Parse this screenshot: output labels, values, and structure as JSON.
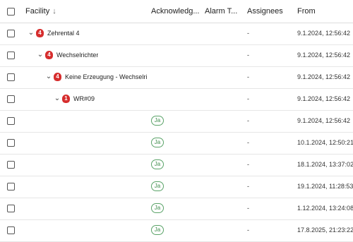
{
  "columns": {
    "facility": "Facility",
    "acknowledged": "Acknowledg...",
    "alarm_type": "Alarm T...",
    "assignees": "Assignees",
    "from": "From"
  },
  "icons": {
    "sort": "arrow-down-icon",
    "expand": "chevron-down-icon",
    "alarm": "alarm-count-badge-icon"
  },
  "colors": {
    "alarm_red": "#d62d2d",
    "ack_green": "#3d8c4b"
  },
  "rows": [
    {
      "type": "tree",
      "level": 0,
      "count": "4",
      "label": "Zehrental 4",
      "assignees": "-",
      "from": "9.1.2024, 12:56:42"
    },
    {
      "type": "tree",
      "level": 1,
      "count": "4",
      "label": "Wechselrichter",
      "assignees": "-",
      "from": "9.1.2024, 12:56:42"
    },
    {
      "type": "tree",
      "level": 2,
      "count": "4",
      "label": "Keine Erzeugung - Wechselrichter",
      "assignees": "-",
      "from": "9.1.2024, 12:56:42"
    },
    {
      "type": "tree",
      "level": 3,
      "count": "1",
      "label": "WR#09",
      "assignees": "-",
      "from": "9.1.2024, 12:56:42"
    },
    {
      "type": "alarm",
      "ack": "Ja",
      "assignees": "-",
      "from": "9.1.2024, 12:56:42"
    },
    {
      "type": "alarm",
      "ack": "Ja",
      "assignees": "-",
      "from": "10.1.2024, 12:50:21"
    },
    {
      "type": "alarm",
      "ack": "Ja",
      "assignees": "-",
      "from": "18.1.2024, 13:37:02"
    },
    {
      "type": "alarm",
      "ack": "Ja",
      "assignees": "-",
      "from": "19.1.2024, 11:28:53"
    },
    {
      "type": "alarm",
      "ack": "Ja",
      "assignees": "-",
      "from": "1.12.2024, 13:24:08"
    },
    {
      "type": "alarm",
      "ack": "Ja",
      "assignees": "-",
      "from": "17.8.2025, 21:23:22"
    }
  ]
}
